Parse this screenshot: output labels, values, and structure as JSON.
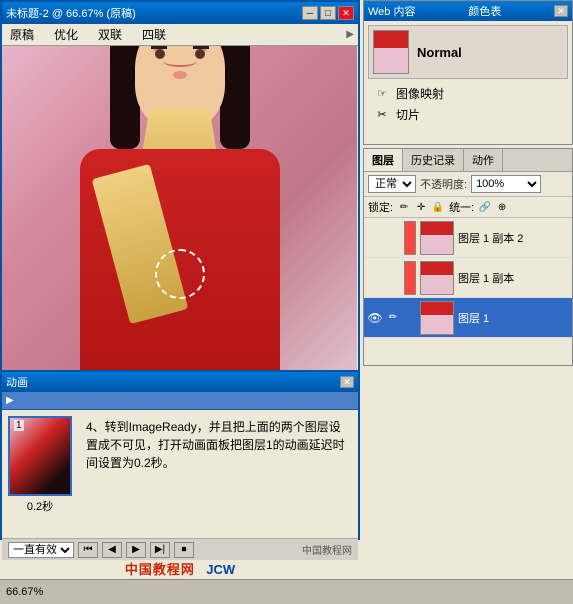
{
  "main_window": {
    "title": "未标题-2 @ 66.67% (原稿)",
    "status_text": "66.67%"
  },
  "menu": {
    "items": [
      "原稿",
      "优化",
      "双联",
      "四联"
    ]
  },
  "web_panel": {
    "title": "Web 内容",
    "tab1": "Web 内容",
    "tab2": "颜色表",
    "normal_label": "Normal",
    "tool1": "图像映射",
    "tool2": "切片"
  },
  "layers_panel": {
    "title": "图层 历史记录 动作",
    "tab1": "图层",
    "tab2": "历史记录",
    "tab3": "动作",
    "blend_mode": "正常",
    "opacity_label": "不透明度:",
    "opacity_value": "100%",
    "lock_label": "锁定:",
    "unite_label": "统一:",
    "layers": [
      {
        "name": "图层 1 副本 2",
        "has_color": true
      },
      {
        "name": "图层 1 副本",
        "has_color": true
      },
      {
        "name": "图层 1",
        "has_color": false,
        "selected": true
      }
    ]
  },
  "anim_panel": {
    "title": "动画",
    "frame1_number": "1",
    "frame1_duration": "0.2秒",
    "description": "4、转到ImageReady，并且把上面的两个图层设置成不可见，打开动画面板把图层1的动画延迟时间设置为0.2秒。",
    "loop_label": "一直有效",
    "controls": [
      "⏮",
      "◀",
      "▶",
      "⏭",
      "⏹"
    ]
  },
  "watermark": {
    "site": "中国教程网",
    "logo": "JCW"
  },
  "icons": {
    "close": "✕",
    "minimize": "─",
    "maximize": "□",
    "arrow_right": "▶",
    "eye": "👁",
    "brush": "✏",
    "hand": "☞",
    "scissors": "✂",
    "lock": "🔒",
    "link": "🔗",
    "layer_lock": "▨"
  }
}
